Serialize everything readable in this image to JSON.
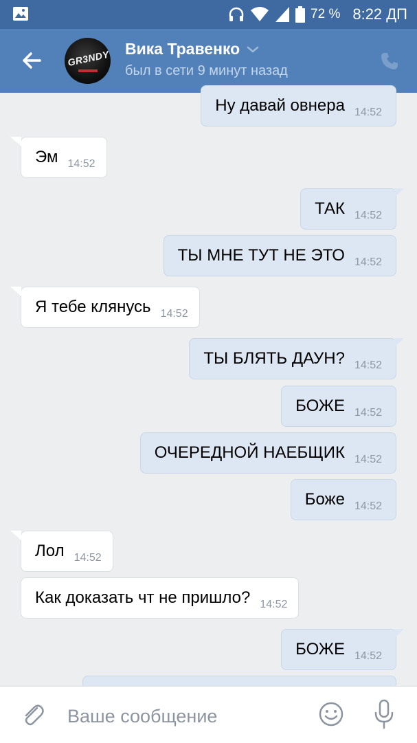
{
  "statusbar": {
    "battery": "72 %",
    "time": "8:22 ДП"
  },
  "header": {
    "name": "Вика Травенко",
    "status": "был в сети 9 минут назад",
    "avatar_text": "GR3NDY"
  },
  "messages": [
    {
      "dir": "out",
      "text": "Ну давай овнера",
      "time": "14:52"
    },
    {
      "dir": "in",
      "text": "Эм",
      "time": "14:52"
    },
    {
      "dir": "out",
      "text": "ТАК",
      "time": "14:52"
    },
    {
      "dir": "out",
      "text": "ТЫ МНЕ ТУТ НЕ ЭТО",
      "time": "14:52"
    },
    {
      "dir": "in",
      "text": "Я тебе клянусь",
      "time": "14:52"
    },
    {
      "dir": "out",
      "text": "ТЫ БЛЯТЬ ДАУН?",
      "time": "14:52"
    },
    {
      "dir": "out",
      "text": "БОЖЕ",
      "time": "14:52"
    },
    {
      "dir": "out",
      "text": "ОЧЕРЕДНОЙ НАЕБЩИК",
      "time": "14:52"
    },
    {
      "dir": "out",
      "text": "Боже",
      "time": "14:52"
    },
    {
      "dir": "in",
      "text": "Лол",
      "time": "14:52"
    },
    {
      "dir": "in",
      "text": "Как доказать чт не пришло?",
      "time": "14:52"
    },
    {
      "dir": "out",
      "text": "БОЖЕ",
      "time": "14:52"
    }
  ],
  "composer": {
    "placeholder": "Ваше сообщение"
  },
  "colors": {
    "header": "#5181b8",
    "statusbar": "#3f6aa1",
    "outgoing": "#dde7f3",
    "incoming": "#ffffff",
    "background": "#edeef0"
  }
}
